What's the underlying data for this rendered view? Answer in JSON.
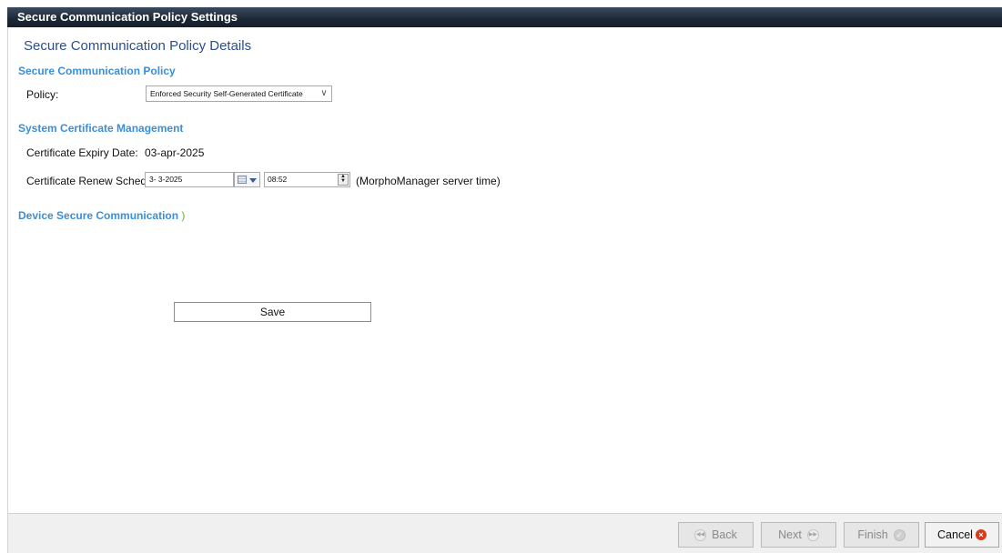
{
  "window": {
    "title": "Secure Communication Policy Settings"
  },
  "page": {
    "heading": "Secure Communication Policy Details"
  },
  "policy_section": {
    "heading": "Secure Communication Policy",
    "policy_label": "Policy:",
    "policy_value": "Enforced Security Self-Generated Certificate"
  },
  "cert_section": {
    "heading": "System Certificate Management",
    "expiry_label": "Certificate Expiry Date:",
    "expiry_value": "03-apr-2025",
    "renew_label": "Certificate Renew Schedule",
    "renew_date": "3- 3-2025",
    "renew_time": "08:52",
    "server_time_note": "(MorphoManager server time)"
  },
  "device_section": {
    "heading": "Device Secure Communication"
  },
  "actions": {
    "save_label": "Save"
  },
  "footer": {
    "back": "Back",
    "next": "Next",
    "finish": "Finish",
    "cancel": "Cancel"
  },
  "colors": {
    "section_heading": "#3a8fd8",
    "page_title": "#2c4f8a",
    "titlebar": "#1c2735",
    "cancel_icon": "#d63b1e"
  }
}
